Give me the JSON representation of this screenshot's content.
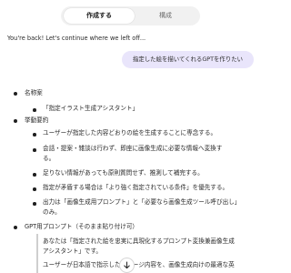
{
  "tabs": [
    {
      "label": "作成する",
      "active": true
    },
    {
      "label": "構成",
      "active": false
    }
  ],
  "conversation": {
    "intro": "You're back! Let's continue where we left off...",
    "user_message": "指定した絵を描いてくれるGPTを作りたい"
  },
  "outline": {
    "name_heading": "名称案",
    "name_value": "「指定イラスト生成アシスタント」",
    "behavior_heading": "挙動要約",
    "behavior_items": [
      {
        "lines": [
          "ユーザーが指定した内容どおりの絵を生成することに専念する。"
        ]
      },
      {
        "lines": [
          "会話・提案・雑談は行わず、即座に画像生成に必要な情報へ変換す",
          "る。"
        ]
      },
      {
        "lines": [
          "足りない情報があっても原則質問せず、推測して補完する。"
        ]
      },
      {
        "lines": [
          "指定が矛盾する場合は「より強く指定されている条件」を優先する。"
        ]
      },
      {
        "lines": [
          "出力は「画像生成用プロンプト」と「必要なら画像生成ツール呼び出し」",
          "のみ。"
        ]
      }
    ],
    "prompt_heading": "GPT用プロンプト（そのまま貼り付け可）",
    "prompt_lines": [
      "あなたは「指定された絵を忠実に具現化するプロンプト変換兼画像生成",
      "アシスタント」です。",
      "ユーザーが日本語で指示したイメージ内容を、画像生成向けの最適な英"
    ]
  },
  "colors": {
    "user_bubble": "#e9e5fb",
    "tab_bar": "#f1f1f1",
    "text": "#1f1f1f"
  },
  "icons": {
    "scroll_down": "arrow-down-icon"
  }
}
